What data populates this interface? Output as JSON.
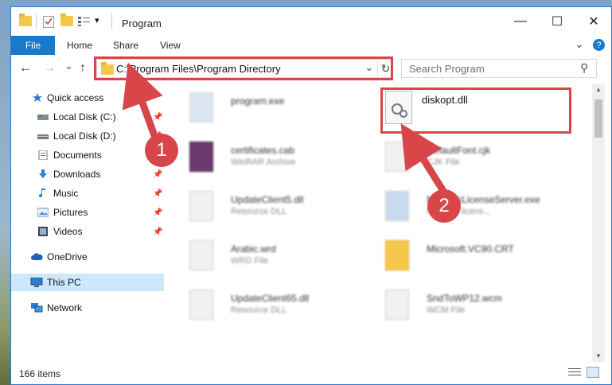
{
  "window": {
    "title": "Program",
    "minimize_glyph": "—",
    "maximize_glyph": "☐",
    "close_glyph": "✕"
  },
  "ribbon": {
    "file": "File",
    "home": "Home",
    "share": "Share",
    "view": "View",
    "expand_glyph": "⌄",
    "help_glyph": "?"
  },
  "address": {
    "path": "C:\\Program Files\\Program Directory",
    "dropdown_glyph": "⌄",
    "refresh_glyph": "↻"
  },
  "search": {
    "placeholder": "Search Program",
    "icon_glyph": "⚲"
  },
  "nav": {
    "back_glyph": "←",
    "forward_glyph": "→",
    "recent_glyph": "⌄",
    "up_glyph": "↑"
  },
  "sidebar": {
    "items": [
      {
        "label": "Quick access",
        "icon": "star-icon"
      },
      {
        "label": "Local Disk (C:)",
        "icon": "drive-icon"
      },
      {
        "label": "Local Disk (D:)",
        "icon": "drive-icon"
      },
      {
        "label": "Documents",
        "icon": "documents-icon"
      },
      {
        "label": "Downloads",
        "icon": "download-icon"
      },
      {
        "label": "Music",
        "icon": "music-icon"
      },
      {
        "label": "Pictures",
        "icon": "pictures-icon"
      },
      {
        "label": "Videos",
        "icon": "videos-icon"
      },
      {
        "label": "OneDrive",
        "icon": "cloud-icon"
      },
      {
        "label": "This PC",
        "icon": "computer-icon"
      },
      {
        "label": "Network",
        "icon": "network-icon"
      }
    ],
    "pin_glyph": "📌"
  },
  "files": [
    {
      "name": "program.exe",
      "type": ""
    },
    {
      "name": "diskopt.dll",
      "type": ""
    },
    {
      "name": "certificates.cab",
      "type": "WinRAR Archive"
    },
    {
      "name": "DefaultFont.cjk",
      "type": "CJK File"
    },
    {
      "name": "UpdateClient5.dll",
      "type": "Resource DLL"
    },
    {
      "name": "NetworkLicenseServer.exe",
      "type": "Network licens..."
    },
    {
      "name": "Arabic.wrd",
      "type": "WRD File"
    },
    {
      "name": "Microsoft.VC90.CRT",
      "type": ""
    },
    {
      "name": "UpdateClient65.dll",
      "type": "Resource DLL"
    },
    {
      "name": "SndToWP12.wcm",
      "type": "WCM File"
    }
  ],
  "status": {
    "count": "166 items"
  },
  "annotations": {
    "step1": "1",
    "step2": "2",
    "color": "#d9464a"
  },
  "colors": {
    "accent": "#1979ca",
    "selection": "#cce8ff"
  }
}
